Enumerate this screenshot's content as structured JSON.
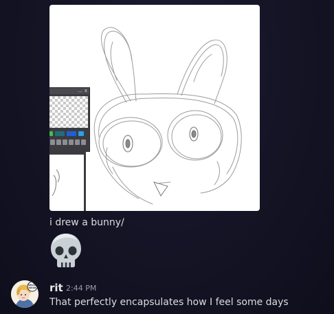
{
  "attachment": {
    "kind": "image",
    "description_icon": "bunny-sketch-image",
    "panel": {
      "title_controls": [
        "...",
        "x"
      ],
      "swatches": [
        "#3fbf4f",
        "#1f6f7a",
        "#1f5fd6",
        "#2aa0e8"
      ]
    }
  },
  "messages": [
    {
      "text": "i drew a bunny/",
      "emoji": "skull-icon"
    },
    {
      "author": "rit",
      "timestamp": "2:44 PM",
      "avatar_badge": "SKULL ISSUE",
      "text": "That perfectly encapsulates how I feel some days"
    }
  ]
}
